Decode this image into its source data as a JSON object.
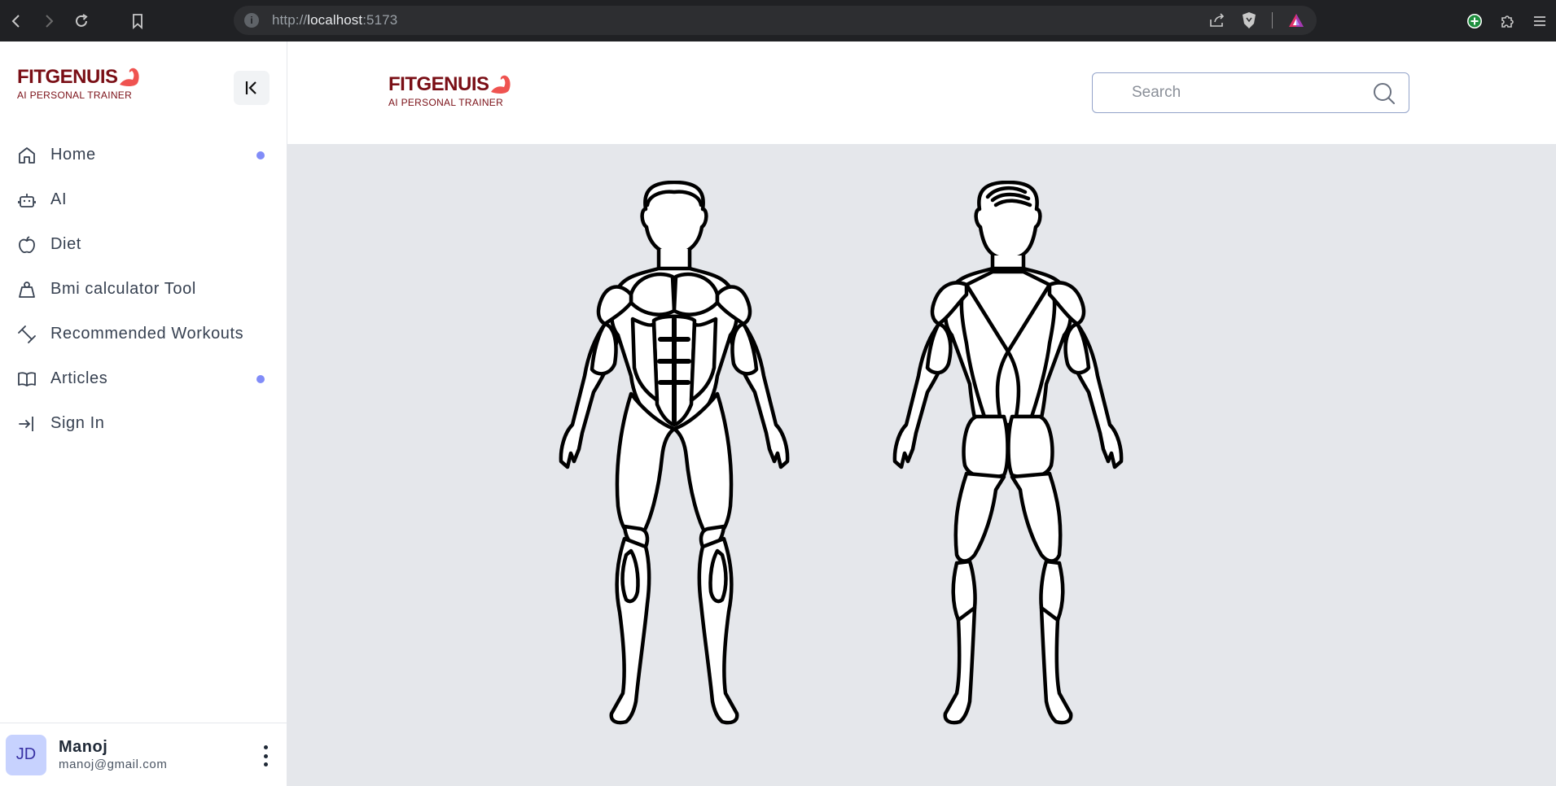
{
  "browser": {
    "url_scheme": "http://",
    "url_host": "localhost",
    "url_port": ":5173"
  },
  "brand": {
    "name": "FITGENUIS",
    "tagline": "AI PERSONAL TRAINER",
    "accent_color": "#7a0f16",
    "logo_icon": "flexed-arm-icon",
    "logo_color": "#ef5350"
  },
  "sidebar": {
    "collapse_icon": "collapse-left-icon",
    "items": [
      {
        "label": "Home",
        "icon": "home-icon",
        "dot": true
      },
      {
        "label": "AI",
        "icon": "robot-icon",
        "dot": false
      },
      {
        "label": "Diet",
        "icon": "apple-icon",
        "dot": false
      },
      {
        "label": "Bmi calculator Tool",
        "icon": "weight-icon",
        "dot": false
      },
      {
        "label": "Recommended Workouts",
        "icon": "dumbbell-icon",
        "dot": false
      },
      {
        "label": "Articles",
        "icon": "book-icon",
        "dot": true
      },
      {
        "label": "Sign In",
        "icon": "sign-in-icon",
        "dot": false
      }
    ],
    "dot_color": "#818cf8"
  },
  "user": {
    "initials": "JD",
    "name": "Manoj",
    "email": "manoj@gmail.com"
  },
  "search": {
    "placeholder": "Search"
  },
  "body_map": {
    "views": [
      "front-body-figure",
      "back-body-figure"
    ]
  }
}
